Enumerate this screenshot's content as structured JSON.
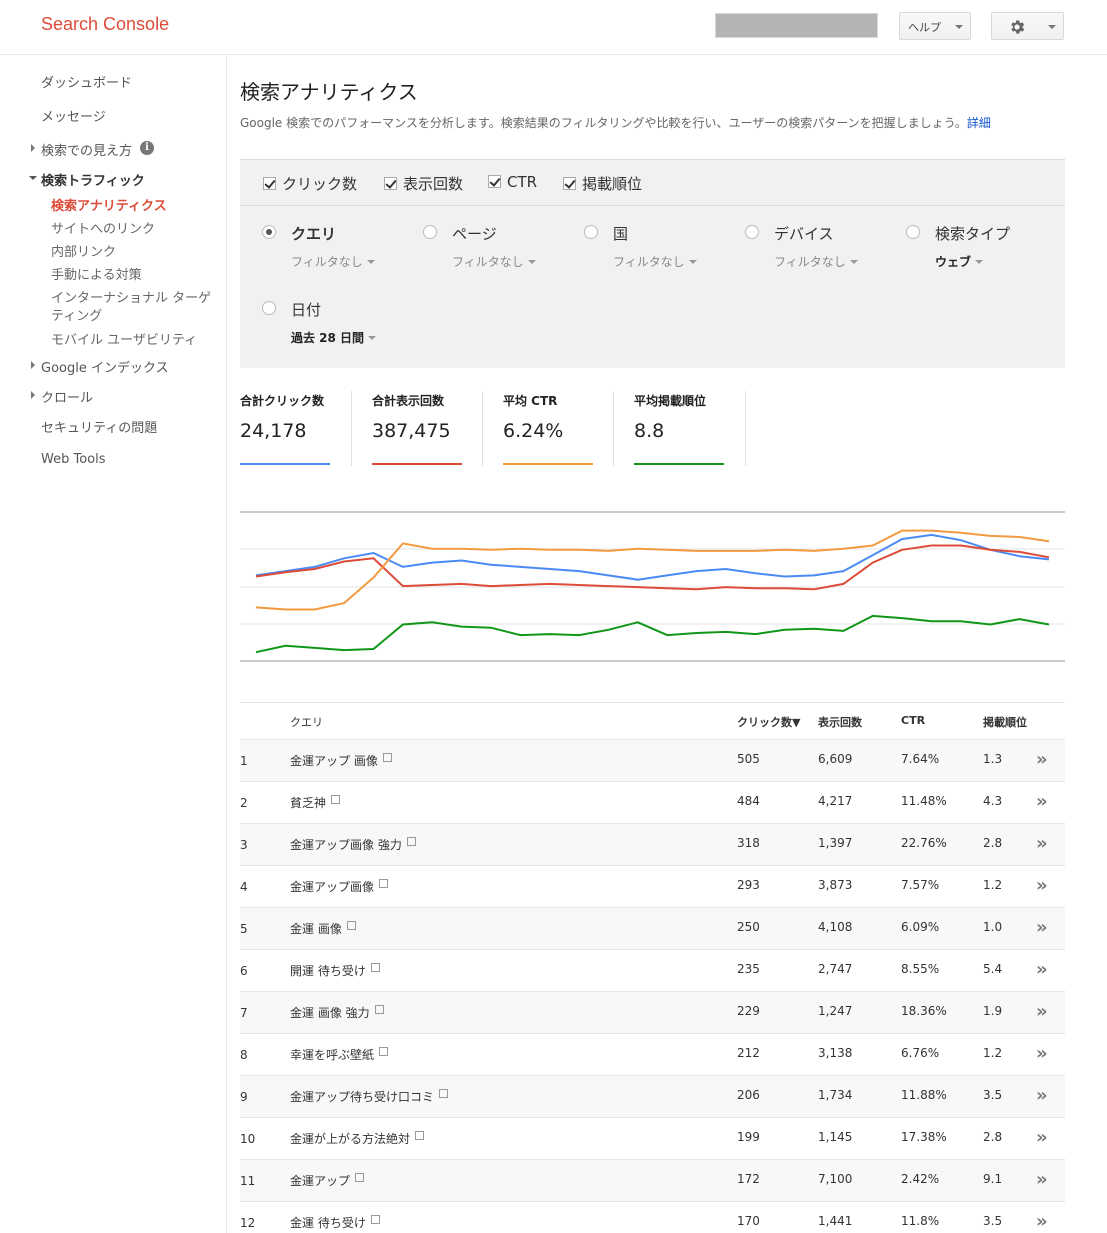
{
  "header": {
    "logo": "Search Console",
    "help_label": "ヘルプ"
  },
  "sidebar": {
    "items": [
      {
        "label": "ダッシュボード"
      },
      {
        "label": "メッセージ"
      },
      {
        "label": "検索での見え方"
      },
      {
        "label": "検索トラフィック"
      },
      {
        "label": "検索アナリティクス"
      },
      {
        "label": "サイトへのリンク"
      },
      {
        "label": "内部リンク"
      },
      {
        "label": "手動による対策"
      },
      {
        "label": "インターナショナル ターゲ"
      },
      {
        "label": "ティング"
      },
      {
        "label": "モバイル ユーザビリティ"
      },
      {
        "label": "Google インデックス"
      },
      {
        "label": "クロール"
      },
      {
        "label": "セキュリティの問題"
      },
      {
        "label": "Web Tools"
      }
    ]
  },
  "page": {
    "title": "検索アナリティクス",
    "description": "Google 検索でのパフォーマンスを分析します。検索結果のフィルタリングや比較を行い、ユーザーの検索パターンを把握しましょう。",
    "details_link": "詳細"
  },
  "metrics": [
    {
      "label": "クリック数",
      "checked": true
    },
    {
      "label": "表示回数",
      "checked": true
    },
    {
      "label": "CTR",
      "checked": true
    },
    {
      "label": "掲載順位",
      "checked": true
    }
  ],
  "dimensions": [
    {
      "label": "クエリ",
      "filter": "フィルタなし",
      "selected": true
    },
    {
      "label": "ページ",
      "filter": "フィルタなし",
      "selected": false
    },
    {
      "label": "国",
      "filter": "フィルタなし",
      "selected": false
    },
    {
      "label": "デバイス",
      "filter": "フィルタなし",
      "selected": false
    },
    {
      "label": "検索タイプ",
      "filter": "ウェブ",
      "selected": false
    },
    {
      "label": "日付",
      "filter": "過去 28 日間",
      "selected": false
    }
  ],
  "totals": [
    {
      "label": "合計クリック数",
      "value": "24,178",
      "color": "#4a8af4"
    },
    {
      "label": "合計表示回数",
      "value": "387,475",
      "color": "#dd4b39"
    },
    {
      "label": "平均 CTR",
      "value": "6.24%",
      "color": "#f4993e"
    },
    {
      "label": "平均掲載順位",
      "value": "8.8",
      "color": "#109618"
    }
  ],
  "chart_data": {
    "type": "line",
    "x": [
      1,
      2,
      3,
      4,
      5,
      6,
      7,
      8,
      9,
      10,
      11,
      12,
      13,
      14,
      15,
      16,
      17,
      18,
      19,
      20,
      21,
      22,
      23,
      24,
      25,
      26,
      27,
      28
    ],
    "series": [
      {
        "color": "#4a8af4",
        "values": [
          584,
          588,
          592,
          600,
          605,
          592,
          596,
          598,
          594,
          592,
          590,
          588,
          584,
          580,
          584,
          588,
          590,
          586,
          583,
          584,
          588,
          603,
          618,
          622,
          617,
          608,
          602,
          599
        ]
      },
      {
        "color": "#dd4b39",
        "values": [
          583,
          587,
          590,
          597,
          600,
          574,
          575,
          576,
          574,
          575,
          576,
          575,
          574,
          573,
          572,
          571,
          573,
          572,
          572,
          571,
          576,
          596,
          608,
          612,
          612,
          608,
          606,
          601
        ]
      },
      {
        "color": "#f4993e",
        "values": [
          554,
          552,
          552,
          558,
          582,
          614,
          609,
          609,
          608,
          609,
          608,
          608,
          607,
          609,
          608,
          607,
          607,
          607,
          608,
          607,
          609,
          612,
          626,
          626,
          624,
          621,
          620,
          616
        ]
      },
      {
        "color": "#109618",
        "values": [
          512,
          518,
          516,
          514,
          515,
          538,
          540,
          536,
          535,
          528,
          529,
          528,
          533,
          540,
          528,
          530,
          531,
          529,
          533,
          534,
          532,
          546,
          544,
          541,
          541,
          538,
          543,
          538
        ]
      }
    ]
  },
  "table": {
    "headers": {
      "query": "クエリ",
      "clicks": "クリック数▼",
      "impressions": "表示回数",
      "ctr": "CTR",
      "position": "掲載順位"
    },
    "go_symbol": "»",
    "rows": [
      {
        "rank": "1",
        "query": "金運アップ 画像",
        "clicks": "505",
        "impressions": "6,609",
        "ctr": "7.64%",
        "position": "1.3"
      },
      {
        "rank": "2",
        "query": "貧乏神",
        "clicks": "484",
        "impressions": "4,217",
        "ctr": "11.48%",
        "position": "4.3"
      },
      {
        "rank": "3",
        "query": "金運アップ画像 強力",
        "clicks": "318",
        "impressions": "1,397",
        "ctr": "22.76%",
        "position": "2.8"
      },
      {
        "rank": "4",
        "query": "金運アップ画像",
        "clicks": "293",
        "impressions": "3,873",
        "ctr": "7.57%",
        "position": "1.2"
      },
      {
        "rank": "5",
        "query": "金運 画像",
        "clicks": "250",
        "impressions": "4,108",
        "ctr": "6.09%",
        "position": "1.0"
      },
      {
        "rank": "6",
        "query": "開運 待ち受け",
        "clicks": "235",
        "impressions": "2,747",
        "ctr": "8.55%",
        "position": "5.4"
      },
      {
        "rank": "7",
        "query": "金運 画像 強力",
        "clicks": "229",
        "impressions": "1,247",
        "ctr": "18.36%",
        "position": "1.9"
      },
      {
        "rank": "8",
        "query": "幸運を呼ぶ壁紙",
        "clicks": "212",
        "impressions": "3,138",
        "ctr": "6.76%",
        "position": "1.2"
      },
      {
        "rank": "9",
        "query": "金運アップ待ち受け口コミ",
        "clicks": "206",
        "impressions": "1,734",
        "ctr": "11.88%",
        "position": "3.5"
      },
      {
        "rank": "10",
        "query": "金運が上がる方法絶対",
        "clicks": "199",
        "impressions": "1,145",
        "ctr": "17.38%",
        "position": "2.8"
      },
      {
        "rank": "11",
        "query": "金運アップ",
        "clicks": "172",
        "impressions": "7,100",
        "ctr": "2.42%",
        "position": "9.1"
      },
      {
        "rank": "12",
        "query": "金運 待ち受け",
        "clicks": "170",
        "impressions": "1,441",
        "ctr": "11.8%",
        "position": "3.5"
      }
    ]
  }
}
